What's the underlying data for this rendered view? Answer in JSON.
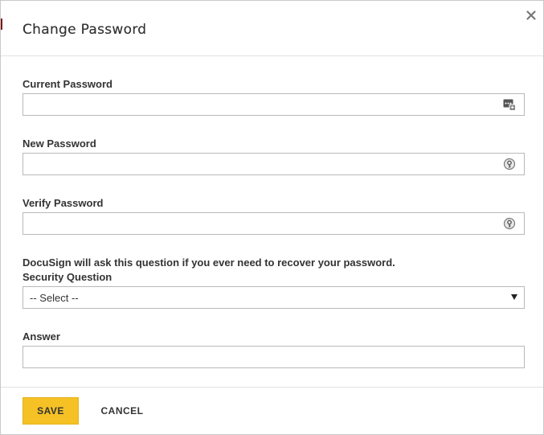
{
  "dialog": {
    "title": "Change Password",
    "close_icon": "close-icon"
  },
  "current_password": {
    "label": "Current Password",
    "value": "",
    "icon": "password-manager-icon"
  },
  "new_password": {
    "label": "New Password",
    "value": "",
    "icon": "password-key-icon"
  },
  "verify_password": {
    "label": "Verify Password",
    "value": "",
    "icon": "password-key-icon"
  },
  "security": {
    "helper_text": "DocuSign will ask this question if you ever need to recover your password.",
    "label": "Security Question",
    "selected": "-- Select --"
  },
  "answer": {
    "label": "Answer",
    "value": ""
  },
  "footer": {
    "save_label": "SAVE",
    "cancel_label": "CANCEL"
  },
  "colors": {
    "accent": "#f5c125",
    "text": "#333333",
    "border": "#b9b9b9"
  }
}
